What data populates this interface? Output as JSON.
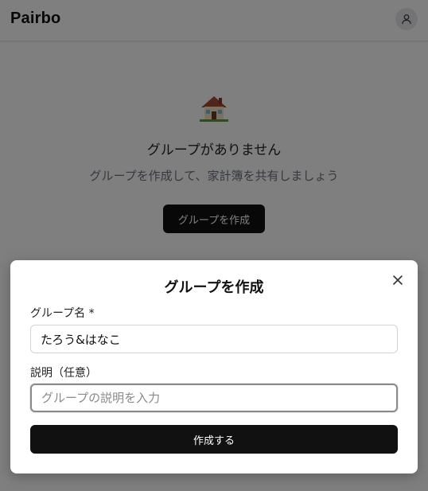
{
  "header": {
    "brand": "Pairbo",
    "avatar_icon": "user-icon"
  },
  "empty_state": {
    "icon": "house-icon",
    "title": "グループがありません",
    "subtitle": "グループを作成して、家計簿を共有しましょう",
    "button_label": "グループを作成"
  },
  "modal": {
    "title": "グループを作成",
    "close_icon": "close-icon",
    "name_label": "グループ名 *",
    "name_value": "たろう&はなこ",
    "description_label": "説明（任意）",
    "description_value": "",
    "description_placeholder": "グループの説明を入力",
    "submit_label": "作成する"
  },
  "colors": {
    "primary_button": "#111111",
    "overlay": "rgba(0,0,0,0.5)",
    "muted_text": "#6b7280"
  }
}
